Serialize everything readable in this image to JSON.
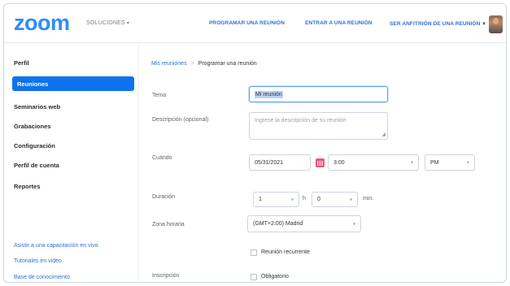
{
  "header": {
    "logo": "zoom",
    "solutions": "SOLUCIONES",
    "nav": [
      {
        "label": "PROGRAMAR UNA REUNIÓN"
      },
      {
        "label": "ENTRAR A UNA REUNIÓN"
      },
      {
        "label": "SER ANFITRIÓN DE UNA REUNIÓN"
      }
    ]
  },
  "sidebar": {
    "items": [
      {
        "label": "Perfil"
      },
      {
        "label": "Reuniones"
      },
      {
        "label": "Seminarios web"
      },
      {
        "label": "Grabaciones"
      },
      {
        "label": "Configuración"
      },
      {
        "label": "Perfil de cuenta"
      },
      {
        "label": "Reportes"
      }
    ],
    "links": [
      {
        "label": "Asistir a una capacitación en vivo"
      },
      {
        "label": "Tutoriales en video"
      },
      {
        "label": "Base de conocimiento"
      }
    ]
  },
  "breadcrumb": {
    "parent": "Mis reuniones",
    "separator": ">",
    "current": "Programar una reunión"
  },
  "form": {
    "topic_label": "Tema",
    "topic_value": "Mi reunión",
    "description_label": "Descripción (opcional)",
    "description_placeholder": "Ingrese la descripción de su reunión",
    "when_label": "Cuándo",
    "date_value": "05/31/2021",
    "time_value": "3:00",
    "ampm_value": "PM",
    "duration_label": "Duración",
    "duration_hours": "1",
    "hours_unit": "h",
    "duration_minutes": "0",
    "minutes_unit": "min.",
    "timezone_label": "Zona horaria",
    "timezone_value": "(GMT+2:00) Madrid",
    "recurring_label": "Reunión recurrente",
    "registration_label": "Inscripción",
    "required_label": "Obligatorio"
  },
  "colors": {
    "brand": "#2d8cff",
    "active_sidebar": "#0e72ed",
    "link": "#2d6fd8",
    "calendar_icon": "#e8557a"
  }
}
